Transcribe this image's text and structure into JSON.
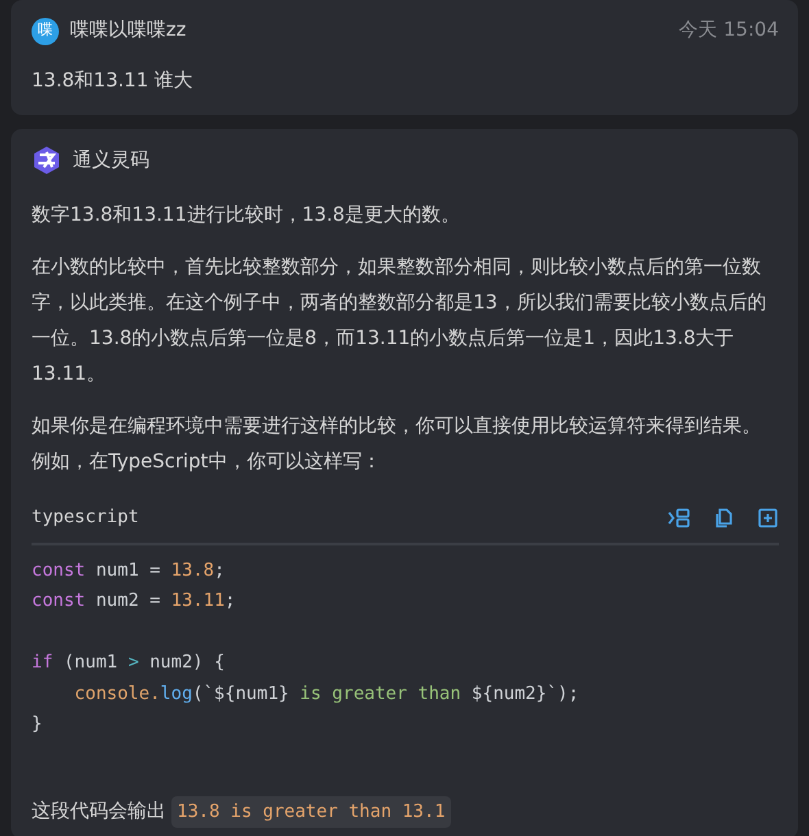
{
  "question": {
    "avatar": "喋",
    "user": "喋喋以喋喋zz",
    "time": "今天 15:04",
    "text": "13.8和13.11 谁大"
  },
  "answer": {
    "assistant": "通义灵码",
    "paragraphs": [
      "数字13.8和13.11进行比较时，13.8是更大的数。",
      "在小数的比较中，首先比较整数部分，如果整数部分相同，则比较小数点后的第一位数字，以此类推。在这个例子中，两者的整数部分都是13，所以我们需要比较小数点后的一位。13.8的小数点后第一位是8，而13.11的小数点后第一位是1，因此13.8大于13.11。",
      "如果你是在编程环境中需要进行这样的比较，你可以直接使用比较运算符来得到结果。例如，在TypeScript中，你可以这样写："
    ],
    "code": {
      "language": "typescript",
      "lines": [
        {
          "kind": "code",
          "indented": false,
          "tokens": [
            {
              "kind": "keyword",
              "text": "const"
            },
            {
              "kind": "plain",
              "text": " num1 = "
            },
            {
              "kind": "number",
              "text": "13.8"
            },
            {
              "kind": "plain",
              "text": ";"
            }
          ]
        },
        {
          "kind": "code",
          "indented": false,
          "tokens": [
            {
              "kind": "keyword",
              "text": "const"
            },
            {
              "kind": "plain",
              "text": " num2 = "
            },
            {
              "kind": "number",
              "text": "13.11"
            },
            {
              "kind": "plain",
              "text": ";"
            }
          ]
        },
        {
          "kind": "blank"
        },
        {
          "kind": "code",
          "indented": false,
          "tokens": [
            {
              "kind": "keyword",
              "text": "if"
            },
            {
              "kind": "plain",
              "text": " (num1 "
            },
            {
              "kind": "operator",
              "text": ">"
            },
            {
              "kind": "plain",
              "text": " num2) {"
            }
          ]
        },
        {
          "kind": "code",
          "indented": true,
          "tokens": [
            {
              "kind": "object",
              "text": "console."
            },
            {
              "kind": "method",
              "text": "log"
            },
            {
              "kind": "plain",
              "text": "(`${num1}"
            },
            {
              "kind": "string",
              "text": " is greater than "
            },
            {
              "kind": "plain",
              "text": "${num2}`);"
            }
          ]
        },
        {
          "kind": "code",
          "indented": false,
          "tokens": [
            {
              "kind": "plain",
              "text": "}"
            }
          ]
        }
      ]
    },
    "output_label": "这段代码会输出",
    "output_code": "13.8 is greater than 13.1"
  }
}
